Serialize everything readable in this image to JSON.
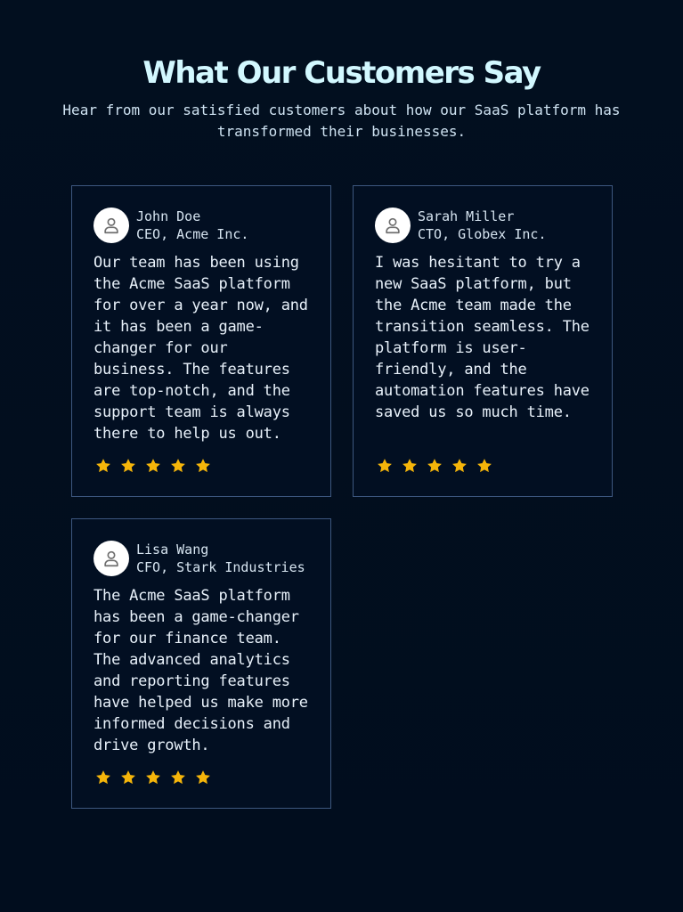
{
  "section": {
    "title": "What Our Customers Say",
    "subtitle": "Hear from our satisfied customers about how our SaaS platform has transformed their businesses."
  },
  "colors": {
    "background": "#010d1e",
    "card_border": "#3d577f",
    "heading": "#d2f8ff",
    "star": "#f5b50a"
  },
  "testimonials": [
    {
      "name": "John Doe",
      "role": "CEO, Acme Inc.",
      "quote": "Our team has been using the Acme SaaS platform for over a year now, and it has been a game-changer for our business. The features are top-notch, and the support team is always there to help us out.",
      "rating": 5,
      "avatar_icon": "user-icon"
    },
    {
      "name": "Sarah Miller",
      "role": "CTO, Globex Inc.",
      "quote": "I was hesitant to try a new SaaS platform, but the Acme team made the transition seamless. The platform is user-friendly, and the automation features have saved us so much time.",
      "rating": 5,
      "avatar_icon": "user-icon"
    },
    {
      "name": "Lisa Wang",
      "role": "CFO, Stark Industries",
      "quote": "The Acme SaaS platform has been a game-changer for our finance team. The advanced analytics and reporting features have helped us make more informed decisions and drive growth.",
      "rating": 5,
      "avatar_icon": "user-icon"
    }
  ]
}
